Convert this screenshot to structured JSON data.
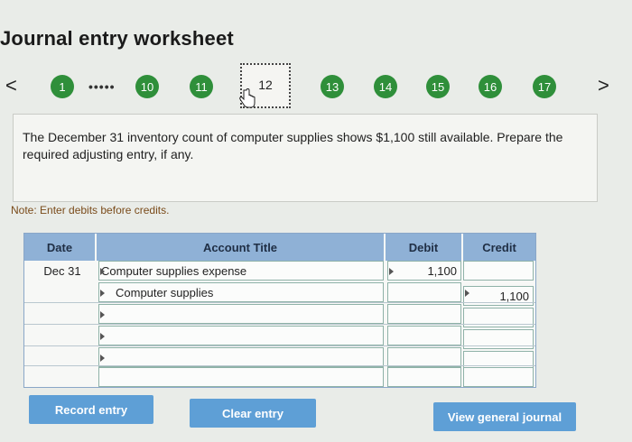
{
  "header": {
    "title": "Journal entry worksheet"
  },
  "nav": {
    "prev_glyph": "<",
    "next_glyph": ">",
    "ellipsis": "•••••",
    "steps": [
      "1",
      "10",
      "11",
      "12",
      "13",
      "14",
      "15",
      "16",
      "17"
    ],
    "current_step": "12"
  },
  "question": {
    "text": "The December 31 inventory count of computer supplies shows $1,100 still available. Prepare the required adjusting entry, if any."
  },
  "note": "Note: Enter debits before credits.",
  "table": {
    "headers": {
      "date": "Date",
      "account": "Account Title",
      "debit": "Debit",
      "credit": "Credit"
    },
    "rows": [
      {
        "date": "Dec 31",
        "account": "Computer supplies expense",
        "debit": "1,100",
        "credit": ""
      },
      {
        "date": "",
        "account": "Computer supplies",
        "debit": "",
        "credit": "1,100"
      },
      {
        "date": "",
        "account": "",
        "debit": "",
        "credit": ""
      },
      {
        "date": "",
        "account": "",
        "debit": "",
        "credit": ""
      },
      {
        "date": "",
        "account": "",
        "debit": "",
        "credit": ""
      },
      {
        "date": "",
        "account": "",
        "debit": "",
        "credit": ""
      }
    ]
  },
  "buttons": {
    "record": "Record entry",
    "clear": "Clear entry",
    "view": "View general journal"
  },
  "colors": {
    "step_green": "#2f8f3a",
    "header_blue": "#8fb1d6",
    "button_blue": "#5e9fd6"
  }
}
